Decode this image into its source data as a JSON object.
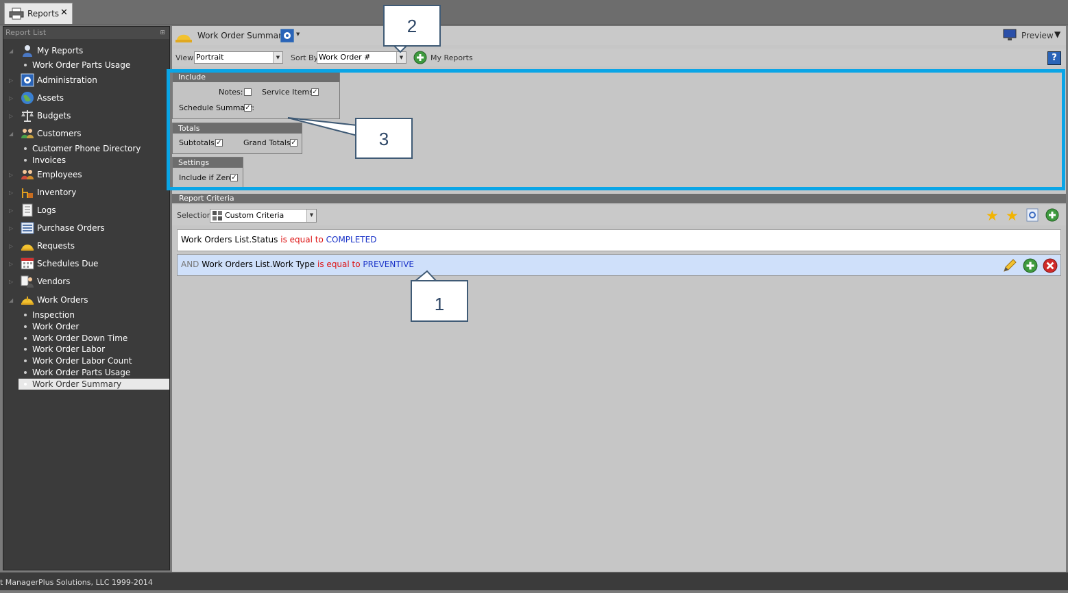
{
  "tab": {
    "label": "Reports",
    "close": "✕"
  },
  "sidebar": {
    "header": "Report List",
    "pin": "📌",
    "nodes": [
      {
        "label": "My Reports",
        "icon": "user-icon"
      },
      {
        "label": "Administration",
        "icon": "admin-gear-icon"
      },
      {
        "label": "Assets",
        "icon": "globe-icon"
      },
      {
        "label": "Budgets",
        "icon": "scale-icon"
      },
      {
        "label": "Customers",
        "icon": "customers-icon"
      },
      {
        "label": "Employees",
        "icon": "employees-icon"
      },
      {
        "label": "Inventory",
        "icon": "inventory-icon"
      },
      {
        "label": "Logs",
        "icon": "log-icon"
      },
      {
        "label": "Purchase Orders",
        "icon": "purchase-orders-icon"
      },
      {
        "label": "Requests",
        "icon": "requests-icon"
      },
      {
        "label": "Schedules Due",
        "icon": "calendar-icon"
      },
      {
        "label": "Vendors",
        "icon": "vendor-icon"
      },
      {
        "label": "Work Orders",
        "icon": "hardhat-icon"
      }
    ],
    "leaves": [
      "Work Order Parts Usage",
      "Customer Phone Directory",
      "Invoices",
      "Inspection",
      "Work Order",
      "Work Order Down Time",
      "Work Order Labor",
      "Work Order Labor Count",
      "Work Order Parts Usage",
      "Work Order Summary"
    ]
  },
  "report": {
    "title": "Work Order Summary",
    "preview": "Preview",
    "view_label": "View",
    "view_value": "Portrait",
    "sortby_label": "Sort By",
    "sortby_value": "Work Order #",
    "my_reports": "My Reports",
    "help": "?"
  },
  "include": {
    "header": "Include",
    "notes_label": "Notes:",
    "notes_checked": false,
    "service_items_label": "Service Items:",
    "service_items_checked": true,
    "schedule_summary_label": "Schedule Summary:",
    "schedule_summary_checked": true
  },
  "totals": {
    "header": "Totals",
    "subtotals_label": "Subtotals:",
    "subtotals_checked": true,
    "grand_totals_label": "Grand Totals:",
    "grand_totals_checked": true
  },
  "settings": {
    "header": "Settings",
    "include_zero_label": "Include if Zero:",
    "include_zero_checked": true
  },
  "criteria": {
    "header": "Report Criteria",
    "selection_label": "Selection",
    "selection_value": "Custom Criteria",
    "rows": [
      {
        "prefix": "",
        "field": "Work Orders List.Status",
        "op": "is equal to",
        "value": "COMPLETED"
      },
      {
        "prefix": "AND",
        "field": "Work Orders List.Work Type",
        "op": "is equal to",
        "value": "PREVENTIVE"
      }
    ]
  },
  "callouts": {
    "c1": "1",
    "c2": "2",
    "c3": "3"
  },
  "status": "t ManagerPlus Solutions, LLC 1999-2014",
  "colors": {
    "highlight_frame": "#0aa5e6",
    "criteria_value": "#1a33c8",
    "criteria_op": "#d11111",
    "selected_row": "#cfe0fa"
  }
}
